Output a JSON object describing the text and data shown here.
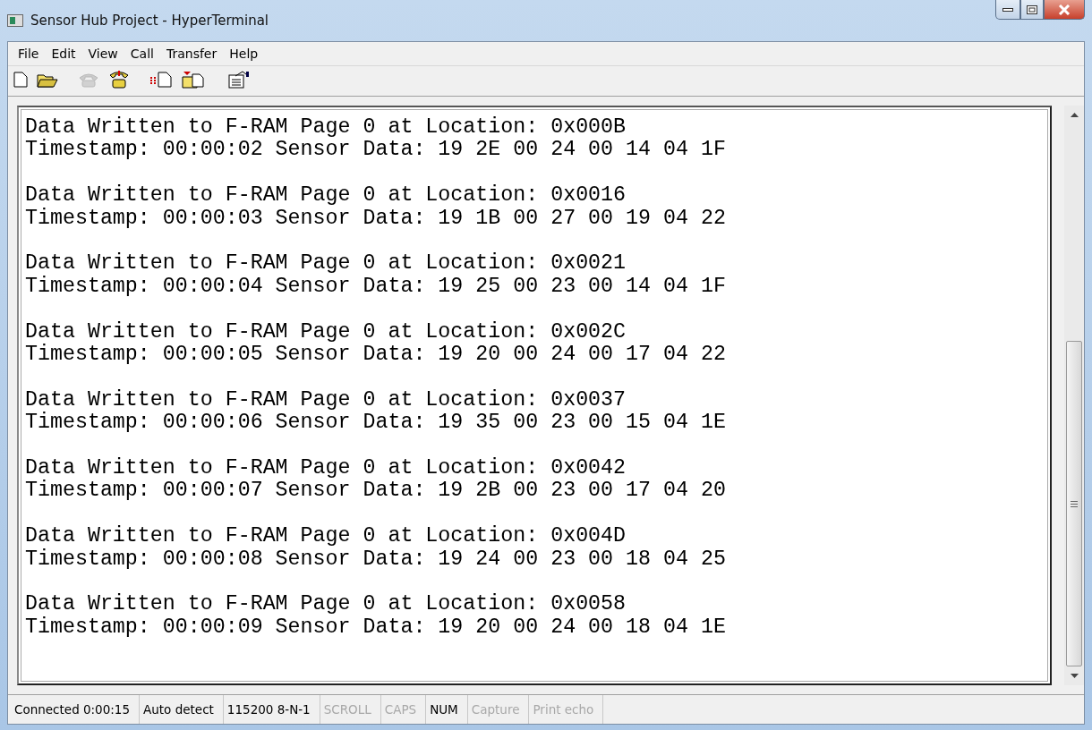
{
  "window": {
    "title": "Sensor Hub Project - HyperTerminal"
  },
  "menu": [
    "File",
    "Edit",
    "View",
    "Call",
    "Transfer",
    "Help"
  ],
  "toolbar": [
    {
      "kind": "new",
      "disabled": false
    },
    {
      "kind": "open",
      "disabled": false
    },
    {
      "kind": "disconnect",
      "disabled": true
    },
    {
      "kind": "dial",
      "disabled": false
    },
    {
      "kind": "send",
      "disabled": false
    },
    {
      "kind": "receive",
      "disabled": false
    },
    {
      "kind": "properties",
      "disabled": false
    }
  ],
  "terminal": {
    "blocks": [
      [
        "Data Written to F-RAM Page 0 at Location: 0x000B",
        "Timestamp: 00:00:02 Sensor Data: 19 2E 00 24 00 14 04 1F"
      ],
      [
        "Data Written to F-RAM Page 0 at Location: 0x0016",
        "Timestamp: 00:00:03 Sensor Data: 19 1B 00 27 00 19 04 22"
      ],
      [
        "Data Written to F-RAM Page 0 at Location: 0x0021",
        "Timestamp: 00:00:04 Sensor Data: 19 25 00 23 00 14 04 1F"
      ],
      [
        "Data Written to F-RAM Page 0 at Location: 0x002C",
        "Timestamp: 00:00:05 Sensor Data: 19 20 00 24 00 17 04 22"
      ],
      [
        "Data Written to F-RAM Page 0 at Location: 0x0037",
        "Timestamp: 00:00:06 Sensor Data: 19 35 00 23 00 15 04 1E"
      ],
      [
        "Data Written to F-RAM Page 0 at Location: 0x0042",
        "Timestamp: 00:00:07 Sensor Data: 19 2B 00 23 00 17 04 20"
      ],
      [
        "Data Written to F-RAM Page 0 at Location: 0x004D",
        "Timestamp: 00:00:08 Sensor Data: 19 24 00 23 00 18 04 25"
      ],
      [
        "Data Written to F-RAM Page 0 at Location: 0x0058",
        "Timestamp: 00:00:09 Sensor Data: 19 20 00 24 00 18 04 1E"
      ]
    ]
  },
  "status_bar": [
    {
      "text": "Connected 0:00:15",
      "active": true
    },
    {
      "text": "Auto detect",
      "active": true
    },
    {
      "text": "115200 8-N-1",
      "active": true
    },
    {
      "text": "SCROLL",
      "active": false
    },
    {
      "text": "CAPS",
      "active": false
    },
    {
      "text": "NUM",
      "active": true
    },
    {
      "text": "Capture",
      "active": false
    },
    {
      "text": "Print echo",
      "active": false
    }
  ]
}
